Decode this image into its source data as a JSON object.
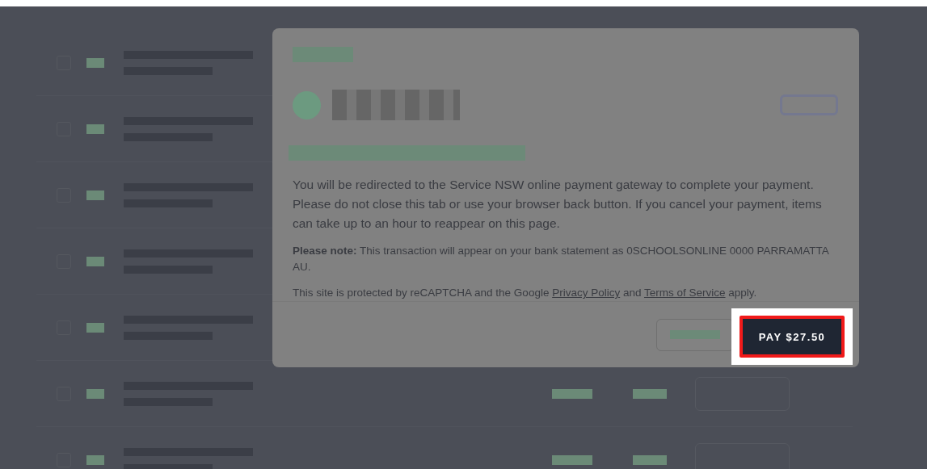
{
  "modal": {
    "message": "You will be redirected to the Service NSW online payment gateway to complete your payment. Please do not close this tab or use your browser back button. If you cancel your payment, items can take up to an hour to reappear on this page.",
    "note": "**Please note:** This transaction will appear on your bank statement as 0SCHOOLSONLINE 0000 PARRAMATTA AU.",
    "recaptcha": {
      "before": "This site is protected by reCAPTCHA and the Google",
      "link_1": "Privacy Policy",
      "between": "and",
      "link_2": "Terms of Service",
      "after": "apply."
    },
    "pay_button": "PAY $27.50"
  },
  "rows": [
    {
      "checked": false
    },
    {
      "checked": false
    },
    {
      "checked": false
    },
    {
      "checked": false
    },
    {
      "checked": false
    },
    {
      "checked": false
    },
    {
      "checked": false
    }
  ]
}
